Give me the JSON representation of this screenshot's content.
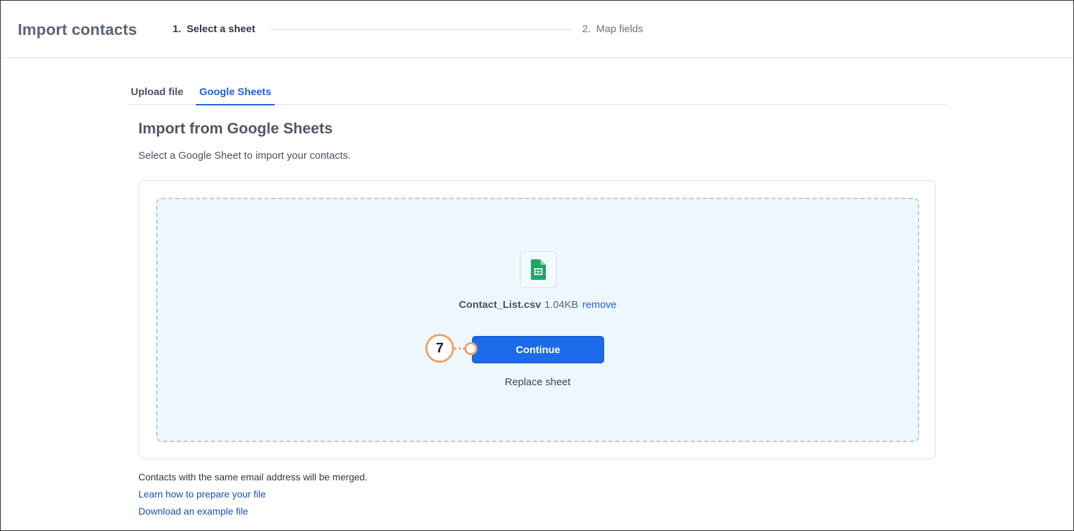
{
  "header": {
    "title": "Import contacts",
    "steps": [
      {
        "number": "1.",
        "label": "Select a sheet",
        "active": true
      },
      {
        "number": "2.",
        "label": "Map fields",
        "active": false
      }
    ]
  },
  "tabs": [
    {
      "label": "Upload file",
      "active": false
    },
    {
      "label": "Google Sheets",
      "active": true
    }
  ],
  "section": {
    "title": "Import from Google Sheets",
    "subtitle": "Select a Google Sheet to import your contacts."
  },
  "file": {
    "icon": "google-sheets-icon",
    "name": "Contact_List.csv",
    "size": "1.04KB",
    "remove_label": "remove"
  },
  "actions": {
    "continue_label": "Continue",
    "replace_label": "Replace sheet"
  },
  "callout": {
    "number": "7"
  },
  "footer": {
    "note": "Contacts with the same email address will be merged.",
    "link_prepare": "Learn how to prepare your file",
    "link_example": "Download an example file"
  },
  "colors": {
    "accent": "#1c6bea",
    "link": "#1d63d8",
    "callout": "#f2a16a",
    "dropzone_bg": "#eef7fd",
    "sheets_green": "#23a566"
  }
}
